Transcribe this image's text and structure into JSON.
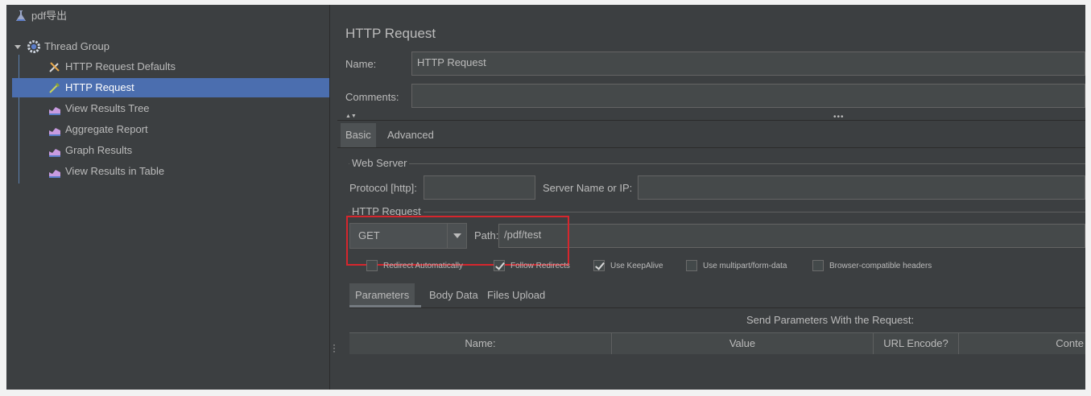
{
  "tree": {
    "root": "pdf导出",
    "group": "Thread Group",
    "items": [
      "HTTP Request Defaults",
      "HTTP Request",
      "View Results Tree",
      "Aggregate Report",
      "Graph Results",
      "View Results in Table"
    ],
    "selected": "HTTP Request"
  },
  "panel": {
    "title": "HTTP Request",
    "name_label": "Name:",
    "name_value": "HTTP Request",
    "comments_label": "Comments:",
    "comments_value": "",
    "tabs": [
      "Basic",
      "Advanced"
    ],
    "active_tab": "Basic"
  },
  "web_server": {
    "legend": "Web Server",
    "protocol_label": "Protocol [http]:",
    "protocol_value": "",
    "server_label": "Server Name or IP:",
    "server_value": ""
  },
  "http_request": {
    "legend": "HTTP Request",
    "method": "GET",
    "path_label": "Path:",
    "path_value": "/pdf/test"
  },
  "options": [
    {
      "label": "Redirect Automatically",
      "checked": false
    },
    {
      "label": "Follow Redirects",
      "checked": true
    },
    {
      "label": "Use KeepAlive",
      "checked": true
    },
    {
      "label": "Use multipart/form-data",
      "checked": false
    },
    {
      "label": "Browser-compatible headers",
      "checked": false
    }
  ],
  "param_tabs": [
    "Parameters",
    "Body Data",
    "Files Upload"
  ],
  "params": {
    "caption": "Send Parameters With the Request:",
    "columns": [
      "Name:",
      "Value",
      "URL Encode?",
      "Conte"
    ]
  },
  "colors": {
    "background": "#3c3f41",
    "selection": "#4b6eaf",
    "highlight_box": "#d6262d"
  }
}
